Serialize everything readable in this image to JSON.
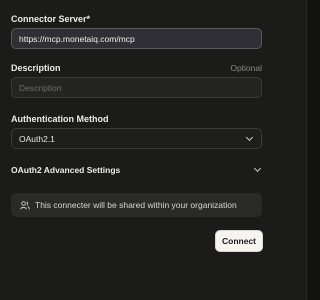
{
  "form": {
    "server_label": "Connector Server*",
    "server_value": "https://mcp.monetaiq.com/mcp",
    "description_label": "Description",
    "description_optional": "Optional",
    "description_placeholder": "Description",
    "auth_label": "Authentication Method",
    "auth_selected": "OAuth2.1",
    "advanced_label": "OAuth2 Advanced Settings",
    "share_notice": "This connecter will be shared within your organization",
    "connect_label": "Connect"
  },
  "icons": {
    "auth_chevron": "chevron-down-icon",
    "advanced_chevron": "chevron-down-icon",
    "share_icon": "users-icon"
  }
}
